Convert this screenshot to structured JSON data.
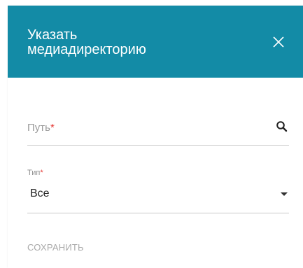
{
  "dialog": {
    "title": "Указать\nмедиадиректорию",
    "close_icon": "close-icon"
  },
  "form": {
    "path": {
      "placeholder": "Путь",
      "required_mark": "*",
      "search_icon": "search-icon"
    },
    "type": {
      "label": "Тип",
      "required_mark": "*",
      "value": "Все",
      "dropdown_icon": "chevron-down-icon"
    }
  },
  "actions": {
    "save_label": "СОХРАНИТЬ"
  },
  "colors": {
    "header": "#138ba6",
    "required": "#e53935",
    "disabled_button": "#a9a9a9"
  }
}
